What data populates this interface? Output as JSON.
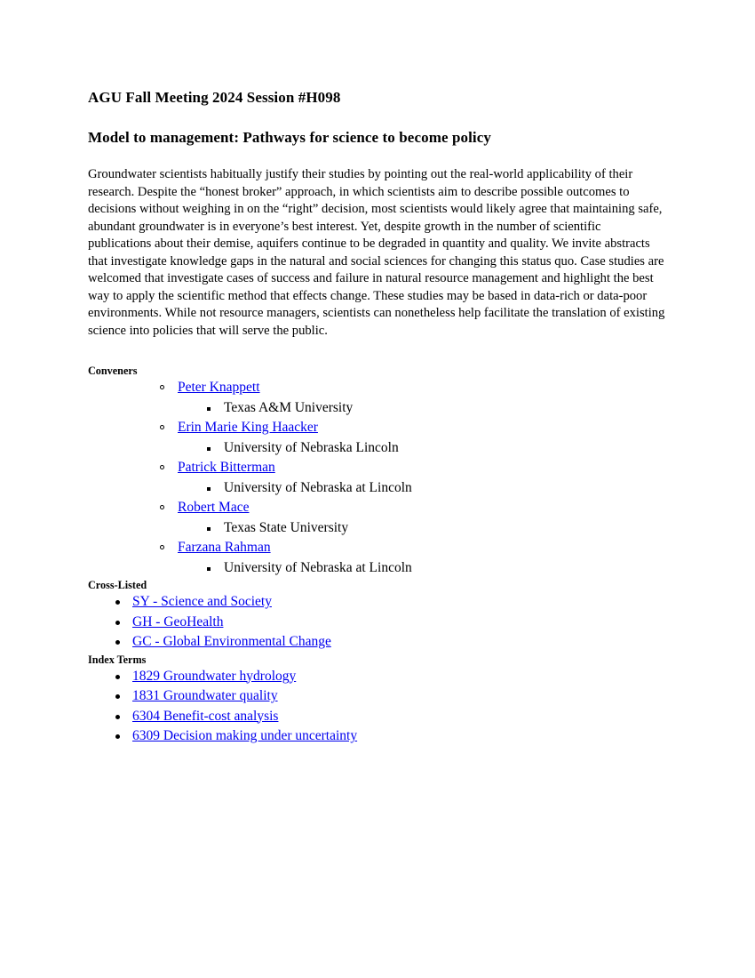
{
  "document": {
    "meeting_heading": "AGU Fall Meeting 2024 Session #H098",
    "session_title": "Model to management: Pathways for science to become policy",
    "abstract": "Groundwater scientists habitually justify their studies by pointing out the real-world applicability of their research. Despite the “honest broker” approach, in which scientists aim to describe possible outcomes to decisions without weighing in on the “right” decision, most scientists would likely agree that maintaining safe, abundant groundwater is in everyone’s best interest. Yet, despite growth in the number of scientific publications about their demise, aquifers continue to be degraded in quantity and quality. We invite abstracts that investigate knowledge gaps in the natural and social sciences for changing this status quo. Case studies are welcomed that investigate cases of success and failure in natural resource management and highlight the best way to apply the scientific method that effects change. These studies may be based in data-rich or data-poor environments. While not resource managers, scientists can nonetheless help facilitate the translation of existing science into policies that will serve the public."
  },
  "conveners": {
    "label": "Conveners",
    "marker_level_1": "hollow-circle-marker",
    "marker_level_2": "filled-square-marker",
    "items": [
      {
        "name": "Peter Knappett",
        "affiliation": "Texas A&M University"
      },
      {
        "name": "Erin Marie King Haacker",
        "affiliation": "University of Nebraska Lincoln"
      },
      {
        "name": "Patrick Bitterman",
        "affiliation": "University of Nebraska at Lincoln"
      },
      {
        "name": "Robert Mace",
        "affiliation": "Texas State University"
      },
      {
        "name": "Farzana Rahman",
        "affiliation": "University of Nebraska at Lincoln"
      }
    ]
  },
  "cross_listed": {
    "label": "Cross-Listed",
    "marker": "filled-dot-marker",
    "items": [
      "SY - Science and Society",
      "GH - GeoHealth",
      "GC - Global Environmental Change"
    ]
  },
  "index_terms": {
    "label": "Index Terms",
    "marker": "filled-dot-marker",
    "items": [
      "1829 Groundwater hydrology",
      "1831 Groundwater quality",
      "6304 Benefit-cost analysis",
      "6309 Decision making under uncertainty"
    ]
  },
  "colors": {
    "link": "#0000EE",
    "text": "#000000",
    "background": "#FFFFFF"
  }
}
